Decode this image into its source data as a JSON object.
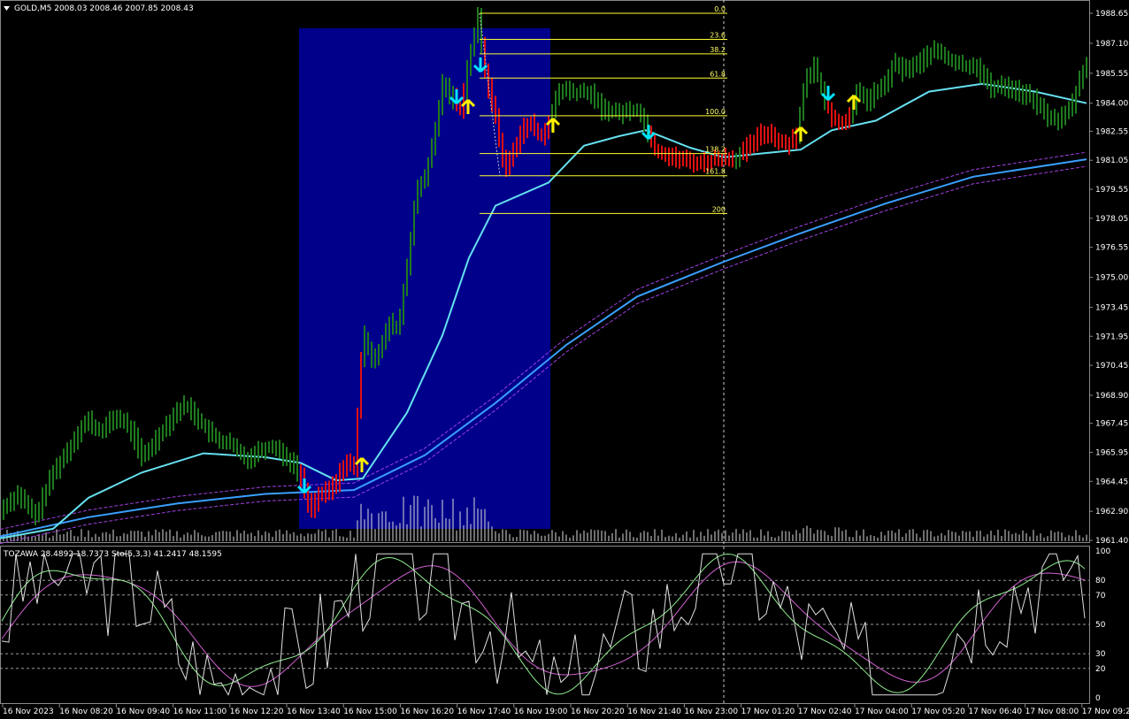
{
  "header": {
    "title": "GOLD,M5  2008.03 2008.46 2007.85 2008.43",
    "menu_arrow": "triangle-down-icon"
  },
  "indicator_header": "TOZAWA 28.4892 18.7373  Sto(5,3,3) 41.2417 48.1595",
  "price_axis": {
    "labels": [
      "1988.65",
      "1987.10",
      "1985.55",
      "1984.00",
      "1982.55",
      "1981.05",
      "1979.55",
      "1978.05",
      "1976.55",
      "1975.00",
      "1973.45",
      "1971.95",
      "1970.45",
      "1968.90",
      "1967.45",
      "1965.95",
      "1964.45",
      "1962.90",
      "1961.40"
    ]
  },
  "osc_axis": {
    "labels": [
      "100",
      "80",
      "70",
      "50",
      "30",
      "20",
      "0"
    ]
  },
  "time_axis": {
    "labels": [
      "16 Nov 2023",
      "16 Nov 08:20",
      "16 Nov 09:40",
      "16 Nov 11:00",
      "16 Nov 12:20",
      "16 Nov 13:40",
      "16 Nov 15:00",
      "16 Nov 16:20",
      "16 Nov 17:40",
      "16 Nov 19:00",
      "16 Nov 20:20",
      "16 Nov 21:40",
      "16 Nov 23:00",
      "17 Nov 01:20",
      "17 Nov 02:40",
      "17 Nov 04:00",
      "17 Nov 05:20",
      "17 Nov 06:40",
      "17 Nov 08:00",
      "17 Nov 09:20"
    ]
  },
  "fibonacci": {
    "levels": [
      "0.0",
      "23.6",
      "38.2",
      "61.8",
      "100.0",
      "138.2",
      "161.8",
      "200"
    ],
    "values": [
      1988.65,
      1987.3,
      1986.55,
      1985.3,
      1983.35,
      1981.4,
      1980.25,
      1978.3
    ]
  },
  "colors": {
    "bull": "#1e7a1e",
    "bear": "#e01010",
    "ma_fast": "#66e0f0",
    "ma_slow": "#3aa0ff",
    "band": "#a040e0",
    "highlight": "#00008b",
    "fib": "#ffff33",
    "arrow_up": "#ffee00",
    "arrow_down": "#00e5ff",
    "volume": "#dddddd",
    "grid": "#888888"
  },
  "chart_data": {
    "type": "line",
    "symbol": "GOLD",
    "timeframe": "M5",
    "ylim": [
      1961.4,
      1988.65
    ],
    "price_path": [
      [
        0,
        1962.9
      ],
      [
        10,
        1963.4
      ],
      [
        20,
        1963.8
      ],
      [
        30,
        1963.2
      ],
      [
        40,
        1962.6
      ],
      [
        50,
        1963.8
      ],
      [
        60,
        1964.9
      ],
      [
        70,
        1965.6
      ],
      [
        80,
        1966.3
      ],
      [
        90,
        1967.2
      ],
      [
        100,
        1967.6
      ],
      [
        110,
        1967.0
      ],
      [
        120,
        1967.3
      ],
      [
        130,
        1967.8
      ],
      [
        140,
        1967.5
      ],
      [
        150,
        1966.9
      ],
      [
        160,
        1965.7
      ],
      [
        170,
        1966.2
      ],
      [
        180,
        1966.9
      ],
      [
        190,
        1967.5
      ],
      [
        200,
        1968.1
      ],
      [
        210,
        1968.4
      ],
      [
        220,
        1967.9
      ],
      [
        230,
        1967.3
      ],
      [
        240,
        1966.8
      ],
      [
        250,
        1966.5
      ],
      [
        260,
        1966.4
      ],
      [
        270,
        1965.9
      ],
      [
        280,
        1965.6
      ],
      [
        290,
        1966.0
      ],
      [
        300,
        1966.2
      ],
      [
        310,
        1966.3
      ],
      [
        320,
        1965.8
      ],
      [
        330,
        1965.4
      ],
      [
        340,
        1964.6
      ],
      [
        350,
        1963.0
      ],
      [
        360,
        1963.7
      ],
      [
        370,
        1963.9
      ],
      [
        380,
        1964.4
      ],
      [
        390,
        1965.5
      ],
      [
        400,
        1965.1
      ],
      [
        410,
        1972.2
      ],
      [
        420,
        1970.8
      ],
      [
        430,
        1971.3
      ],
      [
        440,
        1972.6
      ],
      [
        450,
        1972.3
      ],
      [
        460,
        1975.6
      ],
      [
        470,
        1979.3
      ],
      [
        480,
        1980.2
      ],
      [
        490,
        1982.0
      ],
      [
        500,
        1985.0
      ],
      [
        510,
        1984.4
      ],
      [
        520,
        1983.7
      ],
      [
        530,
        1986.3
      ],
      [
        540,
        1988.4
      ],
      [
        550,
        1985.1
      ],
      [
        560,
        1983.3
      ],
      [
        570,
        1980.5
      ],
      [
        580,
        1981.5
      ],
      [
        590,
        1982.7
      ],
      [
        600,
        1982.9
      ],
      [
        610,
        1982.3
      ],
      [
        620,
        1982.8
      ],
      [
        630,
        1984.6
      ],
      [
        640,
        1984.7
      ],
      [
        650,
        1984.5
      ],
      [
        660,
        1984.6
      ],
      [
        670,
        1984.4
      ],
      [
        680,
        1983.7
      ],
      [
        690,
        1983.6
      ],
      [
        700,
        1983.5
      ],
      [
        710,
        1983.6
      ],
      [
        720,
        1983.7
      ],
      [
        730,
        1982.8
      ],
      [
        740,
        1981.6
      ],
      [
        750,
        1981.4
      ],
      [
        760,
        1981.2
      ],
      [
        770,
        1981.1
      ],
      [
        780,
        1981.0
      ],
      [
        790,
        1980.9
      ],
      [
        800,
        1981.0
      ],
      [
        810,
        1981.1
      ],
      [
        820,
        1981.2
      ],
      [
        830,
        1981.1
      ],
      [
        840,
        1981.5
      ],
      [
        850,
        1981.9
      ],
      [
        860,
        1982.4
      ],
      [
        870,
        1982.5
      ],
      [
        880,
        1982.0
      ],
      [
        890,
        1981.9
      ],
      [
        900,
        1982.4
      ],
      [
        910,
        1985.1
      ],
      [
        920,
        1985.9
      ],
      [
        930,
        1984.5
      ],
      [
        940,
        1983.2
      ],
      [
        950,
        1983.0
      ],
      [
        960,
        1983.3
      ],
      [
        970,
        1984.7
      ],
      [
        980,
        1984.1
      ],
      [
        990,
        1984.6
      ],
      [
        1000,
        1984.9
      ],
      [
        1010,
        1986.1
      ],
      [
        1020,
        1985.7
      ],
      [
        1030,
        1985.9
      ],
      [
        1040,
        1986.1
      ],
      [
        1050,
        1986.6
      ],
      [
        1060,
        1986.7
      ],
      [
        1070,
        1986.3
      ],
      [
        1080,
        1986.1
      ],
      [
        1090,
        1985.9
      ],
      [
        1100,
        1986.0
      ],
      [
        1110,
        1985.5
      ],
      [
        1120,
        1984.7
      ],
      [
        1130,
        1985.0
      ],
      [
        1140,
        1984.8
      ],
      [
        1150,
        1984.6
      ],
      [
        1160,
        1984.4
      ],
      [
        1170,
        1984.1
      ],
      [
        1180,
        1983.5
      ],
      [
        1190,
        1983.1
      ],
      [
        1200,
        1983.3
      ],
      [
        1210,
        1983.7
      ],
      [
        1220,
        1985.2
      ],
      [
        1228,
        1986.1
      ]
    ],
    "series_names_shown": []
  }
}
